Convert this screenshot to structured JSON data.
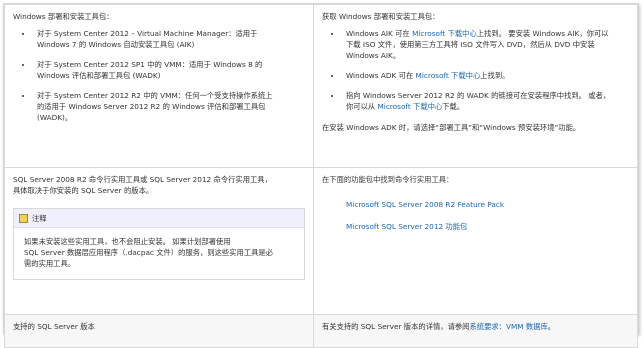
{
  "row1": {
    "left": {
      "heading": "Windows 部署和安装工具包：",
      "items": [
        {
          "lines": [
            "对于 System Center 2012 – Virtual Machine Manager：适用于",
            "Windows 7 的 Windows 自动安装工具包 (AIK)"
          ]
        },
        {
          "lines": [
            "对于 System Center 2012 SP1 中的 VMM：适用于 Windows 8 的",
            "Windows 评估和部署工具包 (WADK)"
          ]
        },
        {
          "lines": [
            "对于 System Center 2012 R2 中的 VMM：任何一个受支持操作系统上",
            "的适用于 Windows Server 2012 R2 的 Windows 评估和部署工具包",
            "(WADK)。"
          ]
        }
      ]
    },
    "right": {
      "heading": "获取 Windows 部署和安装工具包：",
      "item1": {
        "pre": "Windows AIK 可在 ",
        "link": "Microsoft 下载中心",
        "post": "上找到。 要安装 Windows AIK，你可以",
        "line2": "下载 ISO 文件，使用第三方工具将 ISO 文件写入 DVD，然后从 DVD 中安装",
        "line3": "Windows AIK。"
      },
      "item2": {
        "pre": "Windows ADK 可在 ",
        "link": "Microsoft 下载中心",
        "post": "上找到。"
      },
      "item3": {
        "line1": "指向 Windows Server 2012 R2 的 WADK 的链接可在安装程序中找到。 或者，",
        "pre": "你可以从 ",
        "link": "Microsoft 下载中心",
        "post": "下载。"
      },
      "footer": "在安装 Windows ADK 时，请选择“部署工具”和“Windows 预安装环境”功能。"
    }
  },
  "row2": {
    "left": {
      "line1": "SQL Server 2008 R2 命令行实用工具或 SQL Server 2012 命令行实用工具，",
      "line2": "具体取决于你安装的 SQL Server 的版本。",
      "note": {
        "title": "注释",
        "line1": "如果未安装这些实用工具，也不会阻止安装。 如果计划部署使用",
        "line2": "SQL Server 数据层应用程序（.dacpac 文件）的服务，则这些实用工具是必",
        "line3": "需的实用工具。"
      }
    },
    "right": {
      "heading": "在下面的功能包中找到命令行实用工具：",
      "links": [
        "Microsoft SQL Server 2008 R2 Feature Pack",
        "Microsoft SQL Server 2012 功能包"
      ]
    }
  },
  "row3": {
    "left": "支持的 SQL Server 版本",
    "right": {
      "pre": "有关支持的 SQL Server 版本的详情，请参阅",
      "link": "系统要求：VMM 数据库",
      "post": "。"
    }
  },
  "colors": {
    "link": "#1a67b0",
    "note_header_bg": "#f0f0fc",
    "border": "#d9d9d9"
  }
}
